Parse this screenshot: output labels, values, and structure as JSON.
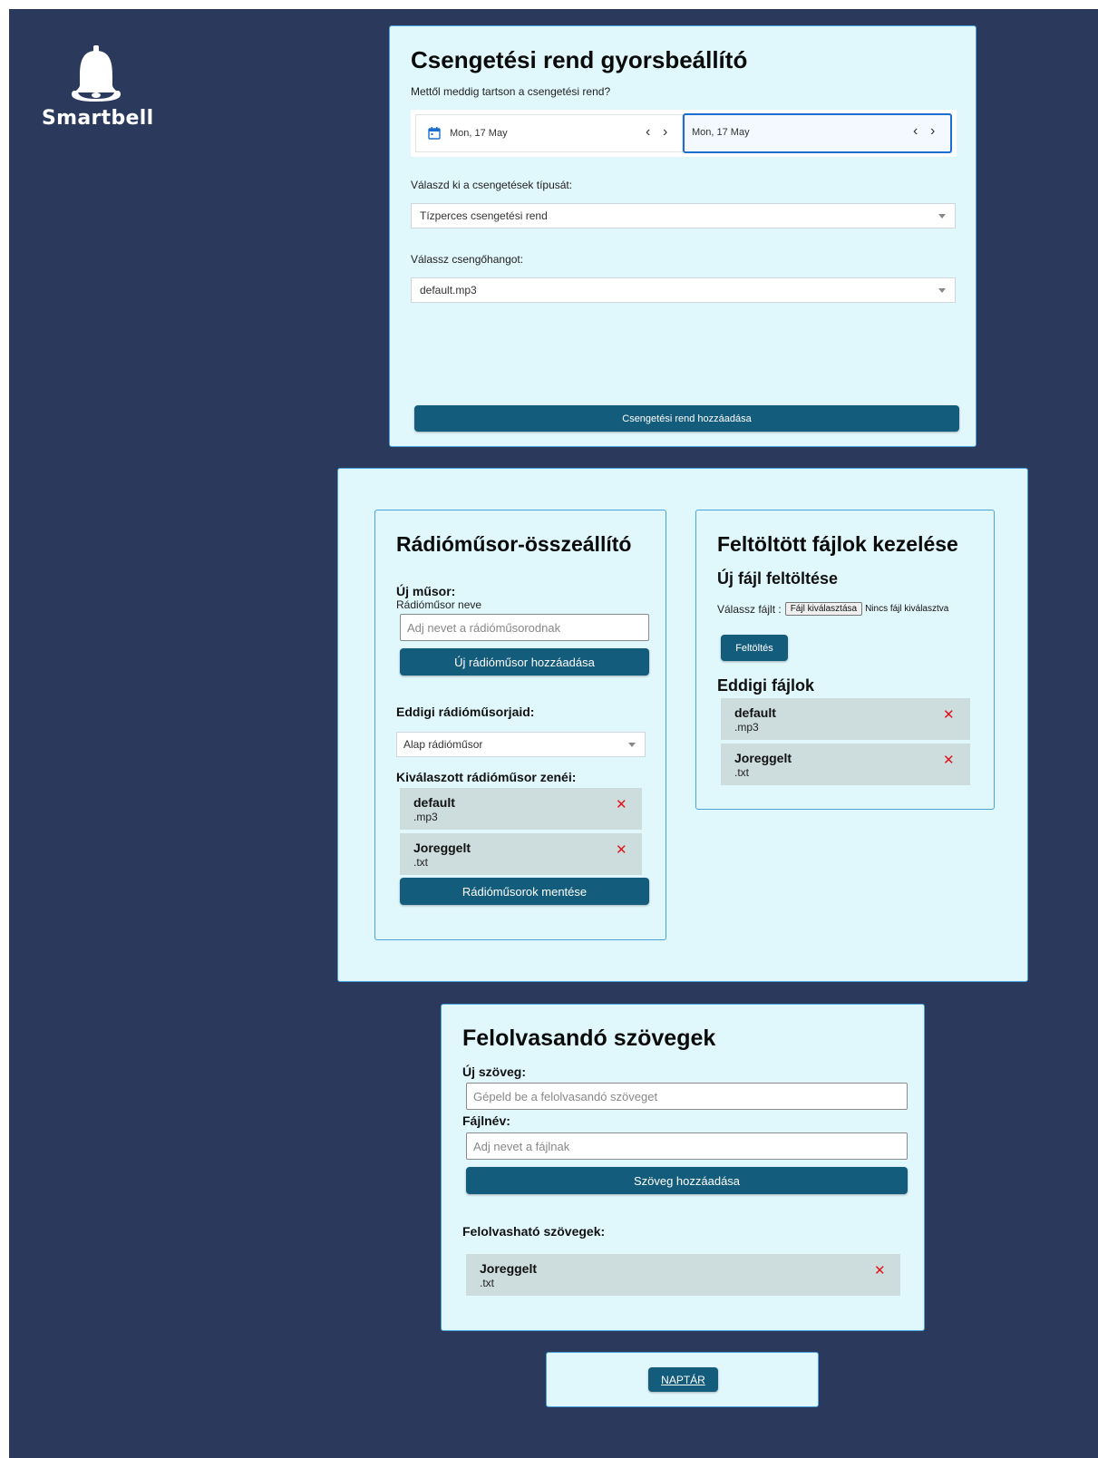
{
  "brand": {
    "name": "Smartbell",
    "icon": "bell-icon"
  },
  "quick_setup": {
    "title": "Csengetési rend gyorsbeállító",
    "range_label": "Mettől meddig tartson a csengetési rend?",
    "start_date": "Mon, 17 May",
    "end_date": "Mon, 17 May",
    "type_label": "Válaszd ki a csengetések típusát:",
    "type_value": "Tízperces csengetési rend",
    "sound_label": "Válassz csengőhangot:",
    "sound_value": "default.mp3",
    "add_button": "Csengetési rend hozzáadása"
  },
  "radio": {
    "title": "Rádióműsor-összeállító",
    "new_label": "Új műsor:",
    "name_label": "Rádióműsor neve",
    "name_placeholder": "Adj nevet a rádióműsorodnak",
    "add_button": "Új rádióműsor hozzáadása",
    "existing_label": "Eddigi rádióműsorjaid:",
    "selected_show": "Alap rádióműsor",
    "songs_label": "Kiválaszott rádióműsor zenéi:",
    "songs": [
      {
        "name": "default",
        "ext": ".mp3"
      },
      {
        "name": "Joreggelt",
        "ext": ".txt"
      }
    ],
    "save_button": "Rádióműsorok mentése"
  },
  "files": {
    "title": "Feltöltött fájlok kezelése",
    "upload_title": "Új fájl feltöltése",
    "choose_label": "Válassz fájlt :",
    "choose_button": "Fájl kiválasztása",
    "no_file": "Nincs fájl kiválasztva",
    "upload_button": "Feltöltés",
    "list_title": "Eddigi fájlok",
    "items": [
      {
        "name": "default",
        "ext": ".mp3"
      },
      {
        "name": "Joreggelt",
        "ext": ".txt"
      }
    ]
  },
  "texts": {
    "title": "Felolvasandó szövegek",
    "new_label": "Új szöveg:",
    "text_placeholder": "Gépeld be a felolvasandó szöveget",
    "filename_label": "Fájlnév:",
    "filename_placeholder": "Adj nevet a fájlnak",
    "add_button": "Szöveg hozzáadása",
    "list_label": "Felolvasható szövegek:",
    "items": [
      {
        "name": "Joreggelt",
        "ext": ".txt"
      }
    ]
  },
  "calendar": {
    "link": "NAPTÁR"
  },
  "colors": {
    "background": "#2b3a5c",
    "card": "#e0f7fc",
    "card_border": "#4aa3df",
    "button": "#145c7c",
    "delete": "#e3131b",
    "item": "#cddcdd"
  }
}
